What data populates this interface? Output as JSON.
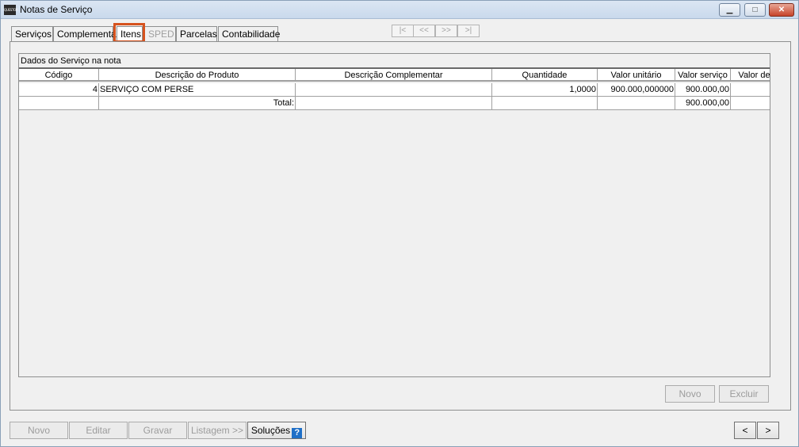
{
  "window": {
    "title": "Notas de Serviço",
    "icon_text": "QUESTOR"
  },
  "tabs": [
    {
      "label": "Serviços"
    },
    {
      "label": "Complementar"
    },
    {
      "label": "Itens"
    },
    {
      "label": "SPED"
    },
    {
      "label": "Parcelas"
    },
    {
      "label": "Contabilidade"
    }
  ],
  "record_nav": {
    "first": "|<",
    "prev": "<<",
    "next": ">>",
    "last": ">|"
  },
  "grid": {
    "caption": "Dados do Serviço na nota",
    "columns": [
      "Código",
      "Descrição do Produto",
      "Descrição Complementar",
      "Quantidade",
      "Valor unitário",
      "Valor serviço",
      "Valor de"
    ],
    "rows": [
      {
        "codigo": "4",
        "descricao": "SERVIÇO COM PERSE",
        "complementar": "",
        "quantidade": "1,0000",
        "valor_unitario": "900.000,000000",
        "valor_servico": "900.000,00",
        "valor_de": ""
      }
    ],
    "total": {
      "label": "Total:",
      "valor_servico": "900.000,00"
    }
  },
  "panel_buttons": {
    "novo": "Novo",
    "excluir": "Excluir"
  },
  "bottom_bar": {
    "novo": "Novo",
    "editar": "Editar",
    "gravar": "Gravar",
    "listagem": "Listagem >>",
    "solucoes": "Soluções",
    "help": "?",
    "prev": "<",
    "next": ">"
  }
}
